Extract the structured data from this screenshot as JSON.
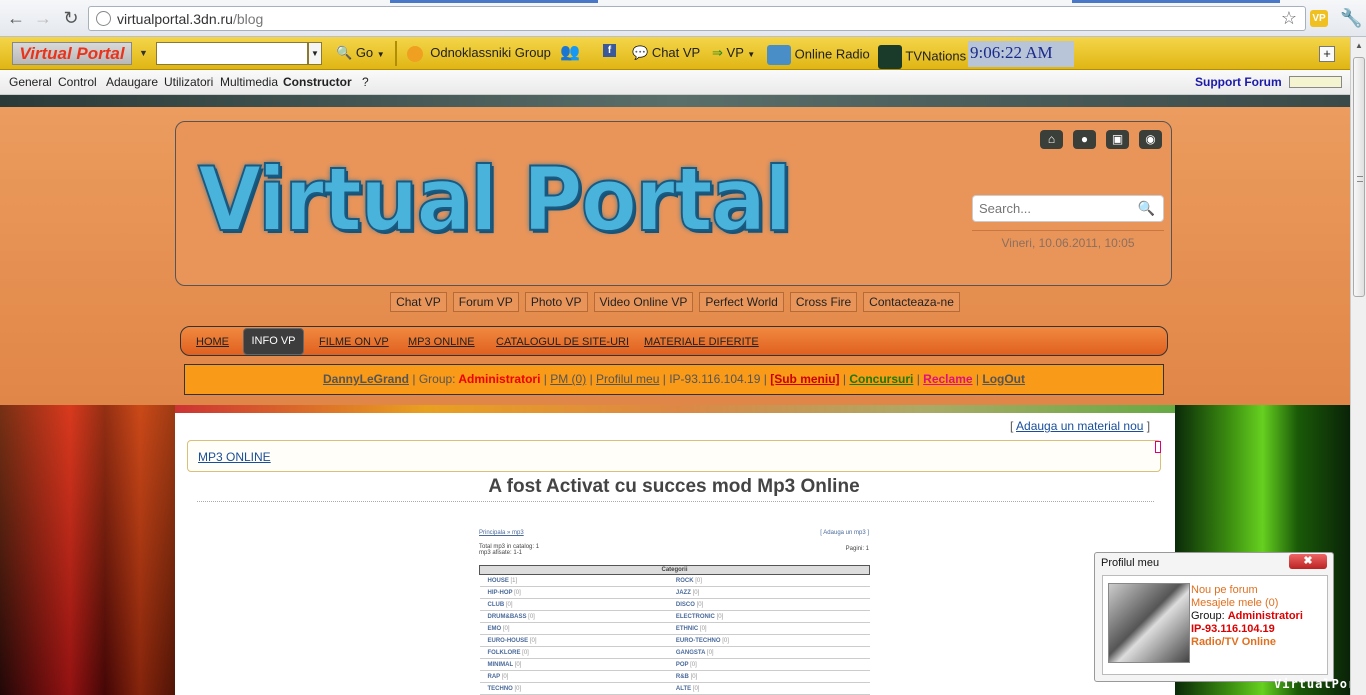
{
  "browser": {
    "url_host": "virtualportal.3dn.ru",
    "url_path": "/blog",
    "back": "←",
    "forward": "→",
    "reload": "↻",
    "star": "☆",
    "ext_label": "VP",
    "wrench": "🔧"
  },
  "toolbar": {
    "logo": "Virtual Portal",
    "go": "Go",
    "items": [
      "Odnoklassniki Group",
      "Chat VP",
      "VP",
      "Online Radio",
      "TVNations"
    ],
    "arrow_glyph": "⇒",
    "clock": "9:06:22 AM",
    "plus": "+"
  },
  "menu": {
    "items": [
      "General",
      "Control",
      "Adaugare",
      "Utilizatori",
      "Multimedia",
      "Constructor",
      "?"
    ],
    "support": "Support Forum"
  },
  "site": {
    "logo": "Virtual Portal",
    "search_placeholder": "Search...",
    "date": "Vineri, 10.06.2011, 10:05",
    "header_icons": [
      "home-icon",
      "user-icon",
      "lock-icon",
      "rss-icon"
    ],
    "links": [
      "Chat VP",
      "Forum VP",
      "Photo VP",
      "Video Online VP",
      "Perfect World",
      "Cross Fire",
      "Contacteaza-ne"
    ],
    "nav": [
      "HOME",
      "INFO VP",
      "FILME ON VP",
      "MP3 ONLINE",
      "CATALOGUL DE SITE-URI",
      "MATERIALE DIFERITE"
    ],
    "userbar": {
      "username": "DannyLeGrand",
      "group_label": "Group:",
      "group": "Administratori",
      "pm": "PM (0)",
      "profile": "Profilul meu",
      "ip": "IP-93.116.104.19",
      "submenu": "[Sub meniu]",
      "contests": "Concursuri",
      "ads": "Reclame",
      "logout": "LogOut"
    }
  },
  "content": {
    "add_material": "Adauga un material nou",
    "breadcrumb": "MP3 ONLINE",
    "headline": "A fost Activat cu succes mod Mp3 Online",
    "shot": {
      "top_left": "Principala » mp3",
      "top_right": "[ Adauga un mp3 ]",
      "totals": "Total mp3 in catalog: 1",
      "shown": "mp3 afisate: 1-1",
      "pages": "Pagini: 1",
      "header": "Categorii",
      "rows": [
        [
          "HOUSE",
          "[1]",
          "ROCK",
          "[0]"
        ],
        [
          "HIP-HOP",
          "[0]",
          "JAZZ",
          "[0]"
        ],
        [
          "CLUB",
          "[0]",
          "DISCO",
          "[0]"
        ],
        [
          "DRUM&BASS",
          "[0]",
          "ELECTRONIC",
          "[0]"
        ],
        [
          "EMO",
          "[0]",
          "ETHNIC",
          "[0]"
        ],
        [
          "EURO-HOUSE",
          "[0]",
          "EURO-TECHNO",
          "[0]"
        ],
        [
          "FOLKLORE",
          "[0]",
          "GANGSTA",
          "[0]"
        ],
        [
          "MINIMAL",
          "[0]",
          "POP",
          "[0]"
        ],
        [
          "RAP",
          "[0]",
          "R&B",
          "[0]"
        ],
        [
          "TECHNO",
          "[0]",
          "ALTE",
          "[0]"
        ]
      ]
    }
  },
  "popup": {
    "title": "Profilul meu",
    "close": "✖",
    "line1": "Nou pe forum",
    "line2": "Mesajele mele (0)",
    "group_label": "Group:",
    "group": "Administratori",
    "ip": "IP-93.116.104.19",
    "radio": "Radio/TV Online"
  },
  "watermark": "VirtualPortal"
}
